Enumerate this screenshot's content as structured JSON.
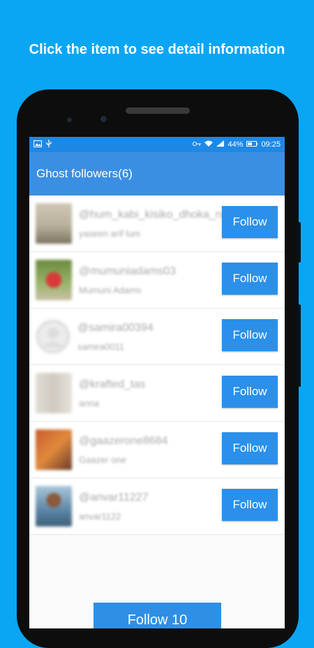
{
  "promo": {
    "text": "Click the item to see detail information"
  },
  "status": {
    "battery": "44%",
    "time": "09:25"
  },
  "appbar": {
    "title": "Ghost followers(6)"
  },
  "followers": [
    {
      "username": "@hum_kabi_kisiko_dhoka_na",
      "display_name": "yaseen arif lum",
      "button": "Follow",
      "avatar_icon": "avatar-photo-outdoor"
    },
    {
      "username": "@mumuniadams03",
      "display_name": "Mumuni Adams",
      "button": "Follow",
      "avatar_icon": "avatar-photo-person-red"
    },
    {
      "username": "@samira00394",
      "display_name": "samira0011",
      "button": "Follow",
      "avatar_icon": "avatar-placeholder"
    },
    {
      "username": "@krafted_tas",
      "display_name": "anna",
      "button": "Follow",
      "avatar_icon": "avatar-photo-room"
    },
    {
      "username": "@gaazerone8684",
      "display_name": "Gaazer one",
      "button": "Follow",
      "avatar_icon": "avatar-photo-person-orange"
    },
    {
      "username": "@anvar11227",
      "display_name": "anvar1122",
      "button": "Follow",
      "avatar_icon": "avatar-photo-child"
    }
  ],
  "bulk_action": {
    "label": "Follow 10"
  }
}
